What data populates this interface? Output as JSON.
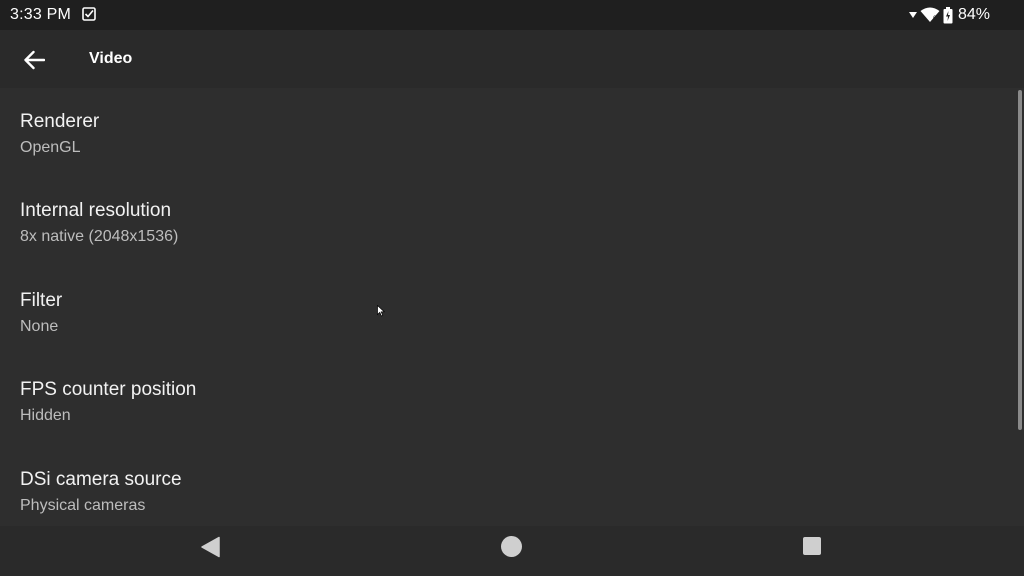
{
  "status_bar": {
    "time": "3:33 PM",
    "notification_icon": "checkbox-icon",
    "signal_icon": "signal-icon",
    "wifi_icon": "wifi-icon",
    "battery_icon": "battery-icon",
    "battery_level": "84%"
  },
  "app_bar": {
    "back_icon": "arrow-back-icon",
    "title": "Video"
  },
  "settings": [
    {
      "title": "Renderer",
      "value": "OpenGL"
    },
    {
      "title": "Internal resolution",
      "value": "8x native (2048x1536)"
    },
    {
      "title": "Filter",
      "value": "None"
    },
    {
      "title": "FPS counter position",
      "value": "Hidden"
    },
    {
      "title": "DSi camera source",
      "value": "Physical cameras"
    }
  ],
  "nav_bar": {
    "back_icon": "nav-back-triangle-icon",
    "home_icon": "nav-home-circle-icon",
    "recents_icon": "nav-recents-square-icon"
  },
  "colors": {
    "background": "#2e2e2e",
    "status_bar": "#1f1f1f",
    "app_bar": "#2a2a2a",
    "title_text": "#f2f2f2",
    "value_text": "#bdbdbd"
  }
}
